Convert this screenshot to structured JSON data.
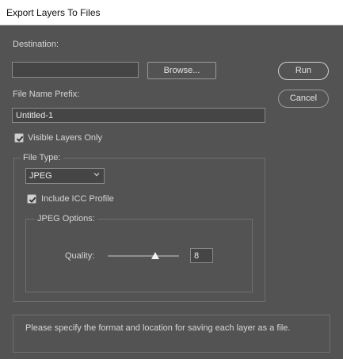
{
  "window": {
    "title": "Export Layers To Files"
  },
  "destination": {
    "label": "Destination:",
    "value": "",
    "browse_label": "Browse..."
  },
  "actions": {
    "run_label": "Run",
    "cancel_label": "Cancel"
  },
  "prefix": {
    "label": "File Name Prefix:",
    "value": "Untitled-1"
  },
  "visible_only": {
    "label": "Visible Layers Only",
    "checked": true
  },
  "file_type": {
    "legend": "File Type:",
    "selected": "JPEG",
    "include_icc": {
      "label": "Include ICC Profile",
      "checked": true
    }
  },
  "jpeg_options": {
    "legend": "JPEG Options:",
    "quality_label": "Quality:",
    "quality_value": "8",
    "quality_min": 0,
    "quality_max": 12
  },
  "status": {
    "message": "Please specify the format and location for saving each layer as a file."
  },
  "colors": {
    "background": "#535353",
    "field": "#454545",
    "text": "#d6d6d6"
  },
  "icons": {
    "checkbox": "checkmark-icon",
    "dropdown": "chevron-down-icon",
    "slider": "triangle-thumb-icon"
  }
}
